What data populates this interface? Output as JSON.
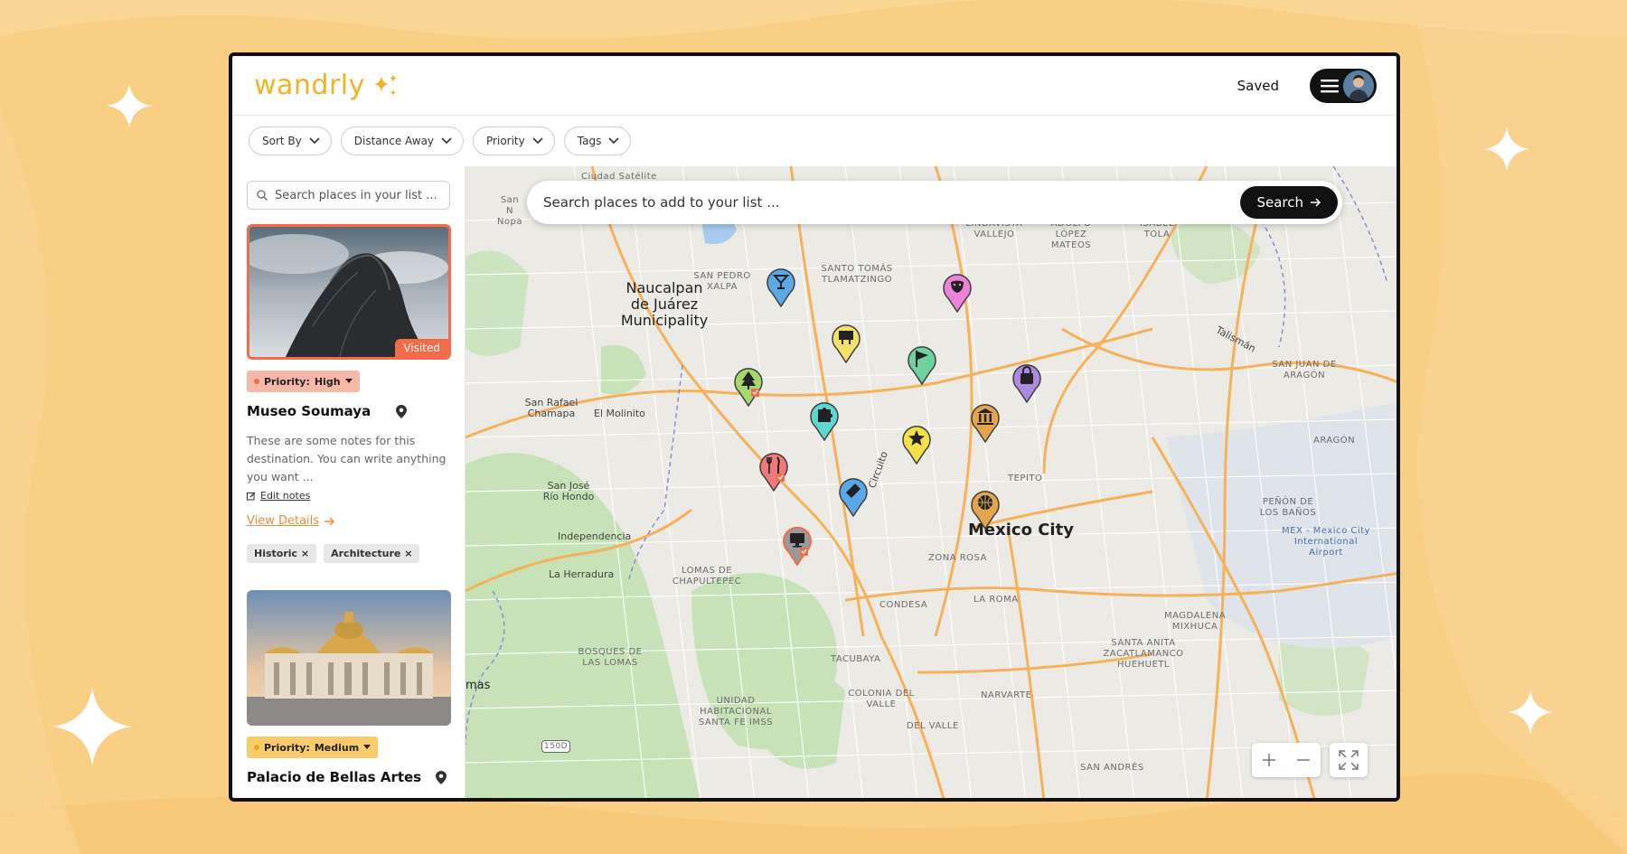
{
  "app": {
    "logo_text": "wandrly",
    "saved_label": "Saved"
  },
  "filters": [
    "Sort By",
    "Distance Away",
    "Priority",
    "Tags"
  ],
  "sidebar": {
    "search_placeholder": "Search places in your list ...",
    "cards": [
      {
        "visited_label": "Visited",
        "priority_label": "Priority:",
        "priority_value": "High",
        "title": "Museo Soumaya",
        "notes": "These are some notes for this destination. You can write anything you want ...",
        "edit_notes": "Edit notes",
        "view_details": "View Details",
        "tags": [
          "Historic",
          "Architecture"
        ]
      },
      {
        "priority_label": "Priority:",
        "priority_value": "Medium",
        "title": "Palacio de Bellas Artes"
      }
    ]
  },
  "map": {
    "search_placeholder": "Search places to add to your list ...",
    "search_button": "Search",
    "labels": {
      "naucalpan": "Naucalpan de Juárez Municipality",
      "mexico_city": "Mexico City",
      "san_pedro": "SAN PEDRO XALPA",
      "santo_tomas": "SANTO TOMÁS TLAMATZINGO",
      "lindavista": "LINDAVISTA VALLEJO",
      "adolfo": "ADOLFO LÓPEZ MATEOS",
      "isabel": "ISABEL TOLA",
      "ciudad_satelite": "Ciudad Satélite",
      "san_nop": "San N Nopa",
      "san_rafael": "San Rafael Chamapa",
      "el_molinito": "El Molinito",
      "san_jose": "San José Río Hondo",
      "independencia": "Independencia",
      "la_herradura": "La Herradura",
      "lomas": "LOMAS DE CHAPULTEPEC",
      "bosques": "BOSQUES DE LAS LOMAS",
      "zona_rosa": "ZONA ROSA",
      "condesa": "CONDESA",
      "la_roma": "LA ROMA",
      "tacubaya": "TACUBAYA",
      "colonia_valle": "COLONIA DEL VALLE",
      "narvarte": "NARVARTE",
      "del_valle": "DEL VALLE",
      "unidad": "UNIDAD HABITACIONAL SANTA FE IMSS",
      "tepito": "TEPITO",
      "aragon": "ARAGÓN",
      "san_juan": "SAN JUAN DE ARAGÓN",
      "penon": "PEÑÓN DE LOS BAÑOS",
      "airport": "MEX - Mexico City International Airport",
      "magdalena": "MAGDALENA MIXHUCA",
      "santa_anita": "SANTA ANITA ZACATLAMANCO HUEHUETL",
      "san_andres": "SAN ANDRÉS",
      "talisman": "Talismán",
      "circuito": "Circuito",
      "mas": "mas",
      "highway": "150D"
    }
  },
  "pins": [
    {
      "icon": "cocktail-icon",
      "color": "#5aa9e6"
    },
    {
      "icon": "theater-masks-icon",
      "color": "#ee82d8"
    },
    {
      "icon": "zoo-sign-icon",
      "color": "#f5e06a"
    },
    {
      "icon": "flag-icon",
      "color": "#6fd1a0"
    },
    {
      "icon": "shopping-bag-icon",
      "color": "#a98be0"
    },
    {
      "icon": "tree-icon",
      "color": "#a5d86e"
    },
    {
      "icon": "puzzle-icon",
      "color": "#5fd6d0"
    },
    {
      "icon": "museum-icon",
      "color": "#e3a64e"
    },
    {
      "icon": "star-icon",
      "color": "#f2e14a"
    },
    {
      "icon": "restaurant-icon",
      "color": "#f07a7a"
    },
    {
      "icon": "ticket-icon",
      "color": "#5aa9e6"
    },
    {
      "icon": "basketball-icon",
      "color": "#e3a64e"
    },
    {
      "icon": "computer-icon",
      "color": "#9a9a9a"
    }
  ],
  "colors": {
    "accent": "#f2b226",
    "visited": "#f26b4b",
    "link": "#f08a3b"
  }
}
